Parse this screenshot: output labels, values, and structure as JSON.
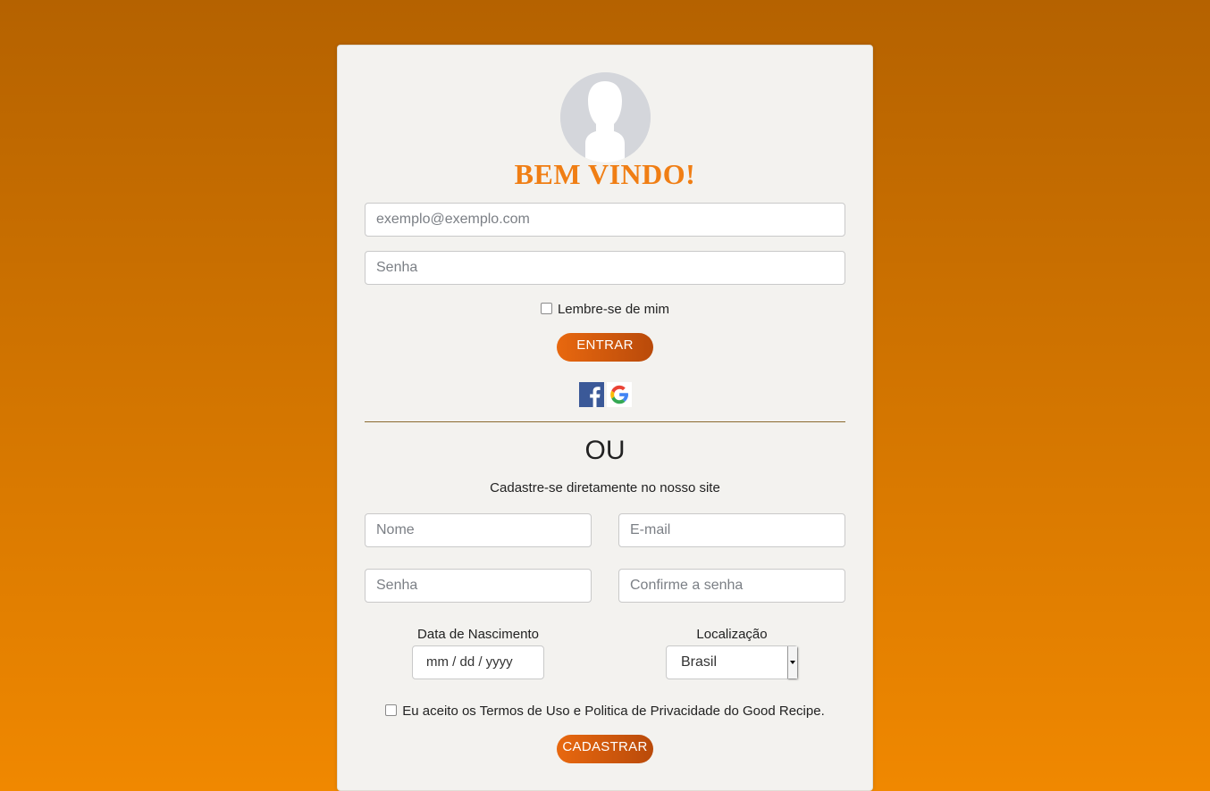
{
  "login": {
    "title": "BEM VINDO!",
    "email_placeholder": "exemplo@exemplo.com",
    "password_placeholder": "Senha",
    "remember_label": "Lembre-se de mim",
    "submit_label": "ENTRAR",
    "social": [
      "facebook-icon",
      "google-icon"
    ]
  },
  "signup": {
    "divider_text": "OU",
    "subtitle": "Cadastre-se diretamente no nosso site",
    "name_placeholder": "Nome",
    "email_placeholder": "E-mail",
    "password_placeholder": "Senha",
    "confirm_placeholder": "Confirme a senha",
    "birthdate_label": "Data de Nascimento",
    "birthdate_placeholder": "mm / dd / yyyy",
    "location_label": "Localização",
    "location_value": "Brasil",
    "terms_label": "Eu aceito os Termos de Uso e Politica de Privacidade do Good Recipe.",
    "submit_label": "CADASTRAR"
  },
  "colors": {
    "accent": "#f07e14",
    "button": "#e8680f",
    "background_top": "#b56200",
    "background_bottom": "#f08800"
  }
}
